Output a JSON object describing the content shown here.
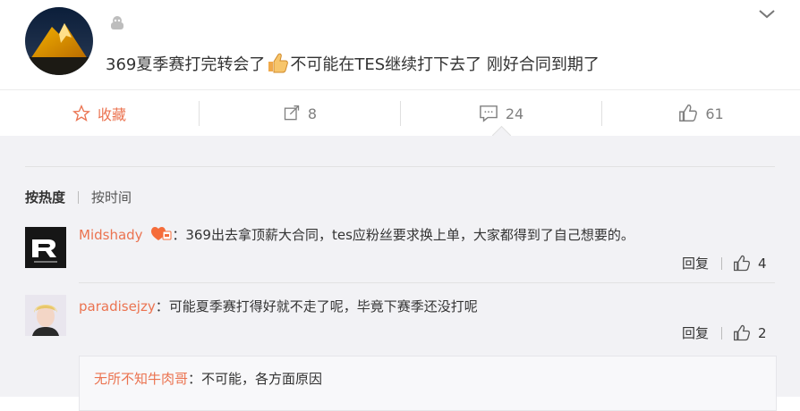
{
  "post": {
    "text_a": "369夏季赛打完转会了",
    "text_b": "不可能在TES继续打下去了   刚好合同到期了"
  },
  "toolbar": {
    "favorite_label": "收藏",
    "repost_count": "8",
    "comment_count": "24",
    "like_count": "61"
  },
  "sort": {
    "hot": "按热度",
    "time": "按时间"
  },
  "comments": [
    {
      "user": "Midshady",
      "sep": "：",
      "text": "369出去拿顶薪大合同，tes应粉丝要求换上单，大家都得到了自己想要的。",
      "reply": "回复",
      "likes": "4"
    },
    {
      "user": "paradisejzy",
      "sep": "：",
      "text": "可能夏季赛打得好就不走了呢，毕竟下赛季还没打呢",
      "reply": "回复",
      "likes": "2"
    }
  ],
  "subreply": {
    "user": "无所不知牛肉哥",
    "sep": "：",
    "text": "不可能，各方面原因"
  },
  "colors": {
    "username": "#eb7350",
    "comments_bg": "#f2f2f5",
    "favorite": "#eb7350"
  }
}
